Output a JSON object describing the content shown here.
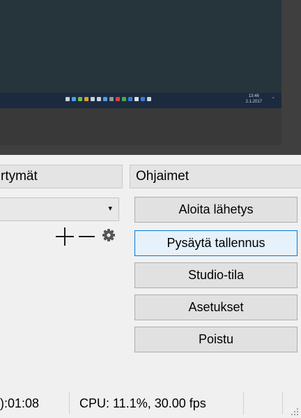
{
  "preview": {
    "clock_time": "13:46",
    "clock_date": "2.1.2017",
    "tray_chevron": "˅",
    "tray_icons": [
      "#c9d2dc",
      "#4aa0e6",
      "#6bbf4a",
      "#e0a020",
      "#c9d2dc",
      "#c9d2dc",
      "#4aa0e6",
      "#8899aa",
      "#e04040",
      "#40b040",
      "#3a7adf",
      "#e0e0e0",
      "#3a7adf",
      "#c9d2dc"
    ]
  },
  "docks": {
    "scenes_header": "rtymät",
    "controls_header": "Ohjaimet",
    "scene_select_arrow": "▾",
    "icons": {
      "add": "plus-icon",
      "remove": "minus-icon",
      "settings": "gear-icon"
    }
  },
  "controls": {
    "start_streaming": "Aloita lähetys",
    "stop_recording": "Pysäytä tallennus",
    "studio_mode": "Studio-tila",
    "settings": "Asetukset",
    "exit": "Poistu"
  },
  "status": {
    "record_time": "):01:08",
    "cpu": "CPU: 11.1%, 30.00 fps"
  },
  "colors": {
    "accent": "#0078d7",
    "active_button_bg": "#e5f1fb"
  }
}
